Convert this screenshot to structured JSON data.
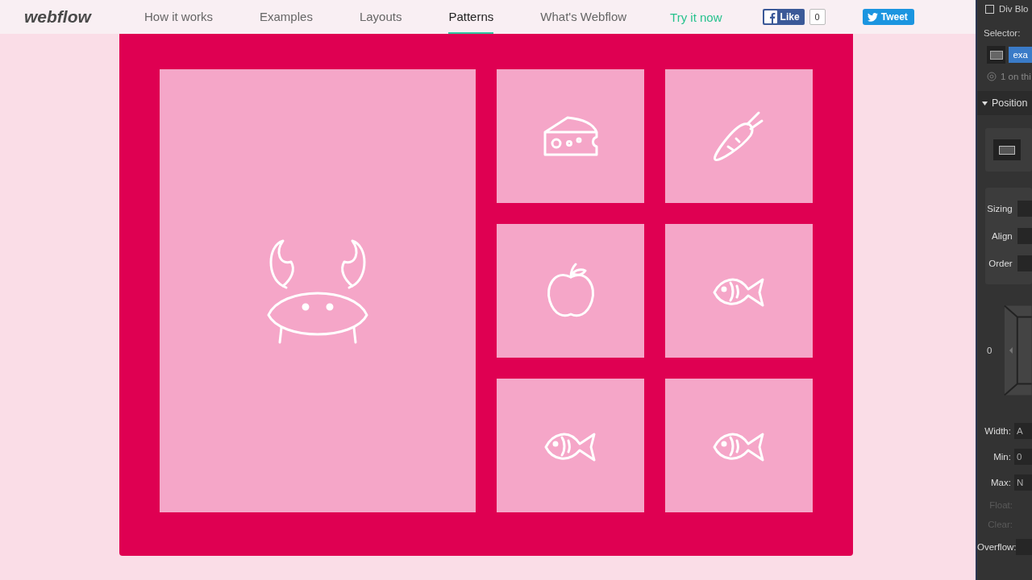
{
  "logo": "webflow",
  "nav": [
    {
      "label": "How it works",
      "selected": false
    },
    {
      "label": "Examples",
      "selected": false
    },
    {
      "label": "Layouts",
      "selected": false
    },
    {
      "label": "Patterns",
      "selected": true
    },
    {
      "label": "What's Webflow",
      "selected": false
    }
  ],
  "cta": "Try it now",
  "like": {
    "label": "Like",
    "count": "0"
  },
  "tweet": "Tweet",
  "tiles": [
    {
      "kind": "crab"
    },
    {
      "kind": "cheese"
    },
    {
      "kind": "carrot"
    },
    {
      "kind": "apple"
    },
    {
      "kind": "fish"
    },
    {
      "kind": "fish"
    },
    {
      "kind": "fish"
    }
  ],
  "panel": {
    "checked": false,
    "element": "Div Blo",
    "selector_label": "Selector:",
    "selector": "exa",
    "count": "1 on thi",
    "section": "Position",
    "flex_rows": [
      {
        "label": "Sizing"
      },
      {
        "label": "Align"
      },
      {
        "label": "Order"
      }
    ],
    "box_value": "0",
    "size_rows": [
      {
        "label": "Width:",
        "value": "A",
        "disabled": false
      },
      {
        "label": "Min:",
        "value": "0",
        "disabled": false
      },
      {
        "label": "Max:",
        "value": "N",
        "disabled": false
      },
      {
        "label": "Float:",
        "disabled": true
      },
      {
        "label": "Clear:",
        "disabled": true
      },
      {
        "label": "Overflow:",
        "disabled": false
      }
    ]
  }
}
